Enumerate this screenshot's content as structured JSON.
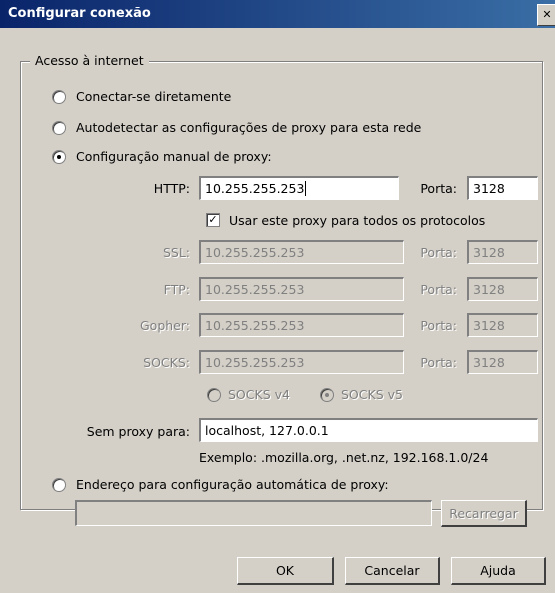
{
  "window": {
    "title": "Configurar conexão",
    "close_glyph": "✕"
  },
  "group": {
    "legend": "Acesso à internet"
  },
  "options": {
    "direct": "Conectar-se diretamente",
    "autodetect": "Autodetectar as configurações de proxy para esta rede",
    "manual": "Configuração manual de proxy:",
    "auto_url": "Endereço para configuração automática de proxy:"
  },
  "manual": {
    "http_label": "HTTP:",
    "http_value": "10.255.255.253",
    "http_port_label": "Porta:",
    "http_port": "3128",
    "use_all_label": "Usar este proxy para todos os protocolos",
    "ssl_label": "SSL:",
    "ssl_value": "10.255.255.253",
    "ssl_port_label": "Porta:",
    "ssl_port": "3128",
    "ftp_label": "FTP:",
    "ftp_value": "10.255.255.253",
    "ftp_port_label": "Porta:",
    "ftp_port": "3128",
    "gopher_label": "Gopher:",
    "gopher_value": "10.255.255.253",
    "gopher_port_label": "Porta:",
    "gopher_port": "3128",
    "socks_label": "SOCKS:",
    "socks_value": "10.255.255.253",
    "socks_port_label": "Porta:",
    "socks_port": "3128",
    "socks_v4": "SOCKS v4",
    "socks_v5": "SOCKS v5",
    "no_proxy_label": "Sem proxy para:",
    "no_proxy_value": "localhost, 127.0.0.1",
    "example": "Exemplo: .mozilla.org, .net.nz, 192.168.1.0/24"
  },
  "auto": {
    "url_value": "",
    "reload_label": "Recarregar"
  },
  "buttons": {
    "ok": "OK",
    "cancel": "Cancelar",
    "help": "Ajuda"
  },
  "state": {
    "selected_mode": "manual",
    "use_all_checked": true,
    "socks_version": "v5"
  },
  "icons": {
    "close": "close-icon",
    "check": "checkmark-icon"
  }
}
